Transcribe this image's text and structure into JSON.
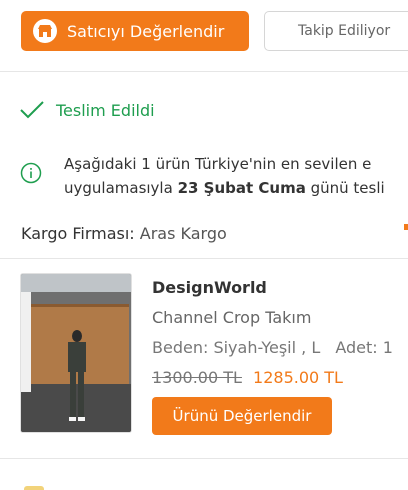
{
  "header": {
    "rate_seller_label": "Satıcıyı Değerlendir",
    "follow_label": "Takip Ediliyor"
  },
  "status": {
    "label": "Teslim Edildi"
  },
  "info": {
    "line1": "Aşağıdaki 1 ürün Türkiye'nin en sevilen e",
    "line2_prefix": "uygulamasıyla ",
    "line2_bold": "23 Şubat Cuma",
    "line2_suffix": " günü tesli"
  },
  "cargo": {
    "label": "Kargo Firması:",
    "value": "Aras Kargo"
  },
  "product": {
    "brand": "DesignWorld",
    "name": "Channel Crop Takım",
    "size_label": "Beden:",
    "size_value": "Siyah-Yeşil , L",
    "qty_label": "Adet:",
    "qty_value": "1",
    "old_price": "1300.00 TL",
    "new_price": "1285.00 TL",
    "rate_button": "Ürünü Değerlendir"
  },
  "colors": {
    "accent": "#f27a1a",
    "success": "#1f9e4f"
  }
}
